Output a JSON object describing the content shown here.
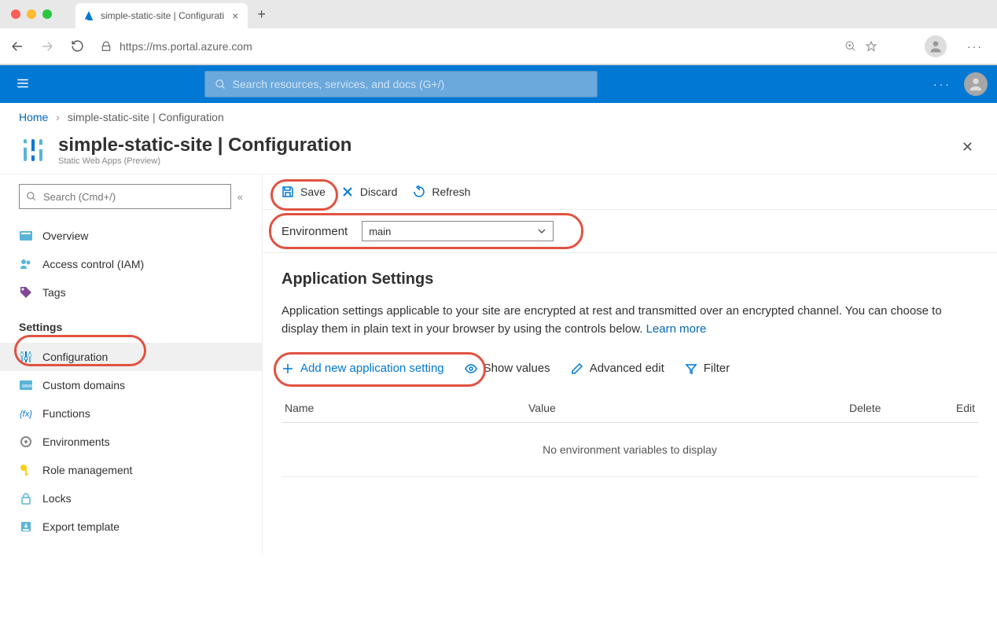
{
  "browser": {
    "tab_title": "simple-static-site | Configurati",
    "url": "https://ms.portal.azure.com"
  },
  "azure_bar": {
    "search_placeholder": "Search resources, services, and docs (G+/)"
  },
  "breadcrumb": {
    "home": "Home",
    "current": "simple-static-site | Configuration"
  },
  "blade": {
    "title": "simple-static-site | Configuration",
    "subtitle": "Static Web Apps (Preview)"
  },
  "sidebar": {
    "search_placeholder": "Search (Cmd+/)",
    "items": {
      "overview": "Overview",
      "iam": "Access control (IAM)",
      "tags": "Tags"
    },
    "settings_heading": "Settings",
    "settings": {
      "configuration": "Configuration",
      "custom_domains": "Custom domains",
      "functions": "Functions",
      "environments": "Environments",
      "role_mgmt": "Role management",
      "locks": "Locks",
      "export": "Export template"
    }
  },
  "toolbar": {
    "save": "Save",
    "discard": "Discard",
    "refresh": "Refresh"
  },
  "environment": {
    "label": "Environment",
    "selected": "main"
  },
  "app_settings": {
    "heading": "Application Settings",
    "desc": "Application settings applicable to your site are encrypted at rest and transmitted over an encrypted channel. You can choose to display them in plain text in your browser by using the controls below. ",
    "learn_more": "Learn more",
    "add": "Add new application setting",
    "show_values": "Show values",
    "advanced_edit": "Advanced edit",
    "filter": "Filter",
    "table": {
      "name": "Name",
      "value": "Value",
      "delete": "Delete",
      "edit": "Edit",
      "empty": "No environment variables to display"
    }
  }
}
